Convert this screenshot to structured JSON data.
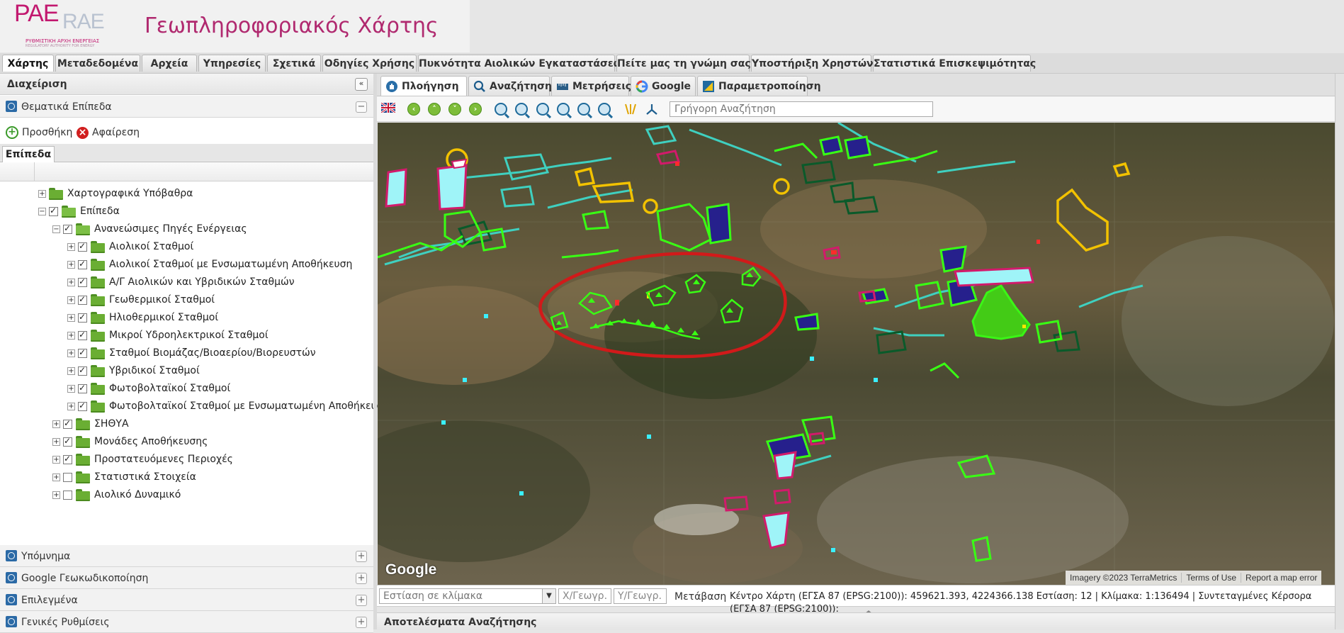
{
  "header": {
    "logo_main": "PAE",
    "logo_secondary": "RAE",
    "logo_sub1": "ΡΥΘΜΙΣΤΙΚΗ ΑΡΧΗ ΕΝΕΡΓΕΙΑΣ",
    "logo_sub2": "REGULATORY AUTHORITY FOR ENERGY",
    "title": "Γεωπληροφοριακός Χάρτης"
  },
  "top_tabs": [
    {
      "label": "Χάρτης",
      "active": true
    },
    {
      "label": "Μεταδεδομένα"
    },
    {
      "label": "Αρχεία"
    },
    {
      "label": "Υπηρεσίες"
    },
    {
      "label": "Σχετικά"
    },
    {
      "label": "Οδηγίες Χρήσης"
    },
    {
      "label": "Πυκνότητα Αιολικών Εγκαταστάσεων"
    },
    {
      "label": "Πείτε μας τη γνώμη σας"
    },
    {
      "label": "Υποστήριξη Χρηστών"
    },
    {
      "label": "Στατιστικά Επισκεψιμότητας"
    }
  ],
  "left_panel": {
    "title": "Διαχείριση",
    "collapse_glyph": "«",
    "thematic_layers": "Θεματικά Επίπεδα",
    "minus_glyph": "−",
    "add_label": "Προσθήκη",
    "remove_label": "Αφαίρεση",
    "layers_tab": "Επίπεδα",
    "bottom_sections": [
      "Υπόμνημα",
      "Google Γεωκωδικοποίηση",
      "Επιλεγμένα",
      "Γενικές Ρυθμίσεις"
    ],
    "plus_glyph": "+"
  },
  "tree": [
    {
      "label": "Χαρτογραφικά Υπόβαθρα",
      "level": 0,
      "expander": "+",
      "checkbox": false,
      "folder_open": false
    },
    {
      "label": "Επίπεδα",
      "level": 0,
      "expander": "−",
      "checkbox": true,
      "checked": true,
      "folder_open": true
    },
    {
      "label": "Ανανεώσιμες Πηγές Ενέργειας",
      "level": 1,
      "expander": "−",
      "checkbox": true,
      "checked": true,
      "folder_open": true
    },
    {
      "label": "Αιολικοί Σταθμοί",
      "level": 2,
      "expander": "+",
      "checkbox": true,
      "checked": true
    },
    {
      "label": "Αιολικοί Σταθμοί με Ενσωματωμένη Αποθήκευση",
      "level": 2,
      "expander": "+",
      "checkbox": true,
      "checked": true
    },
    {
      "label": "Α/Γ Αιολικών και Υβριδικών Σταθμών",
      "level": 2,
      "expander": "+",
      "checkbox": true,
      "checked": true
    },
    {
      "label": "Γεωθερμικοί Σταθμοί",
      "level": 2,
      "expander": "+",
      "checkbox": true,
      "checked": true
    },
    {
      "label": "Ηλιοθερμικοί Σταθμοί",
      "level": 2,
      "expander": "+",
      "checkbox": true,
      "checked": true
    },
    {
      "label": "Μικροί Υδροηλεκτρικοί Σταθμοί",
      "level": 2,
      "expander": "+",
      "checkbox": true,
      "checked": true
    },
    {
      "label": "Σταθμοί Βιομάζας/Βιοαερίου/Βιορευστών",
      "level": 2,
      "expander": "+",
      "checkbox": true,
      "checked": true
    },
    {
      "label": "Υβριδικοί Σταθμοί",
      "level": 2,
      "expander": "+",
      "checkbox": true,
      "checked": true
    },
    {
      "label": "Φωτοβολταϊκοί Σταθμοί",
      "level": 2,
      "expander": "+",
      "checkbox": true,
      "checked": true
    },
    {
      "label": "Φωτοβολταϊκοί Σταθμοί με Ενσωματωμένη Αποθήκευση",
      "level": 2,
      "expander": "+",
      "checkbox": true,
      "checked": true
    },
    {
      "label": "ΣΗΘΥΑ",
      "level": 1,
      "expander": "+",
      "checkbox": true,
      "checked": true
    },
    {
      "label": "Μονάδες Αποθήκευσης",
      "level": 1,
      "expander": "+",
      "checkbox": true,
      "checked": true
    },
    {
      "label": "Προστατευόμενες Περιοχές",
      "level": 1,
      "expander": "+",
      "checkbox": true,
      "checked": true
    },
    {
      "label": "Στατιστικά Στοιχεία",
      "level": 1,
      "expander": "+",
      "checkbox": true,
      "checked": false
    },
    {
      "label": "Αιολικό Δυναμικό",
      "level": 1,
      "expander": "+",
      "checkbox": true,
      "checked": false
    }
  ],
  "map_tabs": [
    {
      "label": "Πλοήγηση",
      "active": true,
      "icon": "navigation-hand-icon"
    },
    {
      "label": "Αναζήτηση",
      "icon": "search-icon"
    },
    {
      "label": "Μετρήσεις",
      "icon": "ruler-icon"
    },
    {
      "label": "Google",
      "icon": "google-g-icon"
    },
    {
      "label": "Παραμετροποίηση",
      "icon": "settings-map-icon"
    }
  ],
  "toolbar": {
    "quick_search_placeholder": "Γρήγορη Αναζήτηση",
    "tools": [
      "uk-flag-icon",
      "pan-left-icon",
      "pan-up-icon",
      "pan-down-icon",
      "pan-right-icon",
      "zoom-in-icon",
      "zoom-out-icon",
      "zoom-box-icon",
      "zoom-extent-icon",
      "zoom-previous-icon",
      "zoom-next-icon",
      "identify-icon",
      "measure-icon"
    ],
    "nav_glyphs": [
      "‹",
      "˄",
      "˅",
      "›"
    ]
  },
  "map": {
    "google_logo": "Google",
    "attribution": [
      "Imagery ©2023 TerraMetrics",
      "Terms of Use",
      "Report a map error"
    ],
    "colors": {
      "wind_green": "#39ff14",
      "pv_cyan": "#3fd0c0",
      "hydro_yellow": "#f2c200",
      "dark_green": "#0a5a2a",
      "protected_magenta": "#d21a6b",
      "fill_navy": "#26208c",
      "highlight_red": "#d11a1a"
    }
  },
  "status_bar": {
    "scale_placeholder": "Εστίαση σε κλίμακα",
    "x_placeholder": "Χ/Γεωγρ.",
    "y_placeholder": "Υ/Γεωγρ.",
    "goto_label": "Μετάβαση",
    "map_info": "Κέντρο Χάρτη (ΕΓΣΑ 87 (EPSG:2100)): 459621.393, 4224366.138 Εστίαση: 12 | Κλίμακα: 1:136494 | Συντεταγμένες Κέρσορα (ΕΓΣΑ 87 (EPSG:2100)):"
  },
  "results": {
    "title": "Αποτελέσματα Αναζήτησης"
  }
}
